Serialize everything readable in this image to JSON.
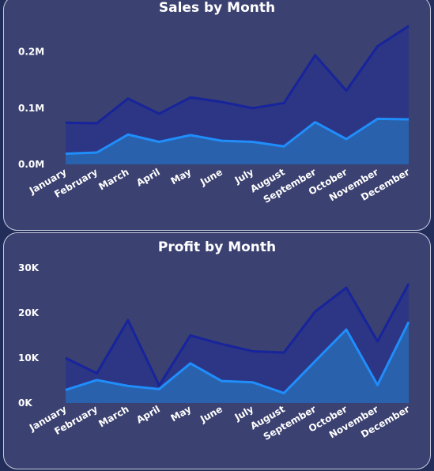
{
  "chart_data": [
    {
      "type": "area",
      "title": "Sales by Month",
      "categories": [
        "January",
        "February",
        "March",
        "April",
        "May",
        "June",
        "July",
        "August",
        "September",
        "October",
        "November",
        "December"
      ],
      "y_ticks": [
        "0.0M",
        "0.1M",
        "0.2M"
      ],
      "ylim": [
        0,
        0.25
      ],
      "series": [
        {
          "values": [
            0.074,
            0.073,
            0.117,
            0.09,
            0.119,
            0.111,
            0.1,
            0.109,
            0.194,
            0.131,
            0.21,
            0.246
          ],
          "color": "#17249b",
          "fill": "#2d3585"
        },
        {
          "values": [
            0.019,
            0.021,
            0.053,
            0.04,
            0.052,
            0.042,
            0.04,
            0.032,
            0.075,
            0.045,
            0.081,
            0.08
          ],
          "color": "#1f8efb",
          "fill": "#2961ad"
        }
      ],
      "grid": false
    },
    {
      "type": "area",
      "title": "Profit by Month",
      "categories": [
        "January",
        "February",
        "March",
        "April",
        "May",
        "June",
        "July",
        "August",
        "September",
        "October",
        "November",
        "December"
      ],
      "y_ticks": [
        "0K",
        "10K",
        "20K",
        "30K"
      ],
      "ylim": [
        0,
        30000
      ],
      "series": [
        {
          "values": [
            10000,
            6600,
            18400,
            3900,
            15000,
            13100,
            11500,
            11200,
            20300,
            25600,
            13700,
            26500
          ],
          "color": "#17249b",
          "fill": "#2d3585"
        },
        {
          "values": [
            2900,
            5100,
            3800,
            3100,
            8800,
            4900,
            4600,
            2200,
            9300,
            16300,
            4000,
            18000
          ],
          "color": "#1f8efb",
          "fill": "#2961ad"
        }
      ],
      "grid": false
    }
  ]
}
